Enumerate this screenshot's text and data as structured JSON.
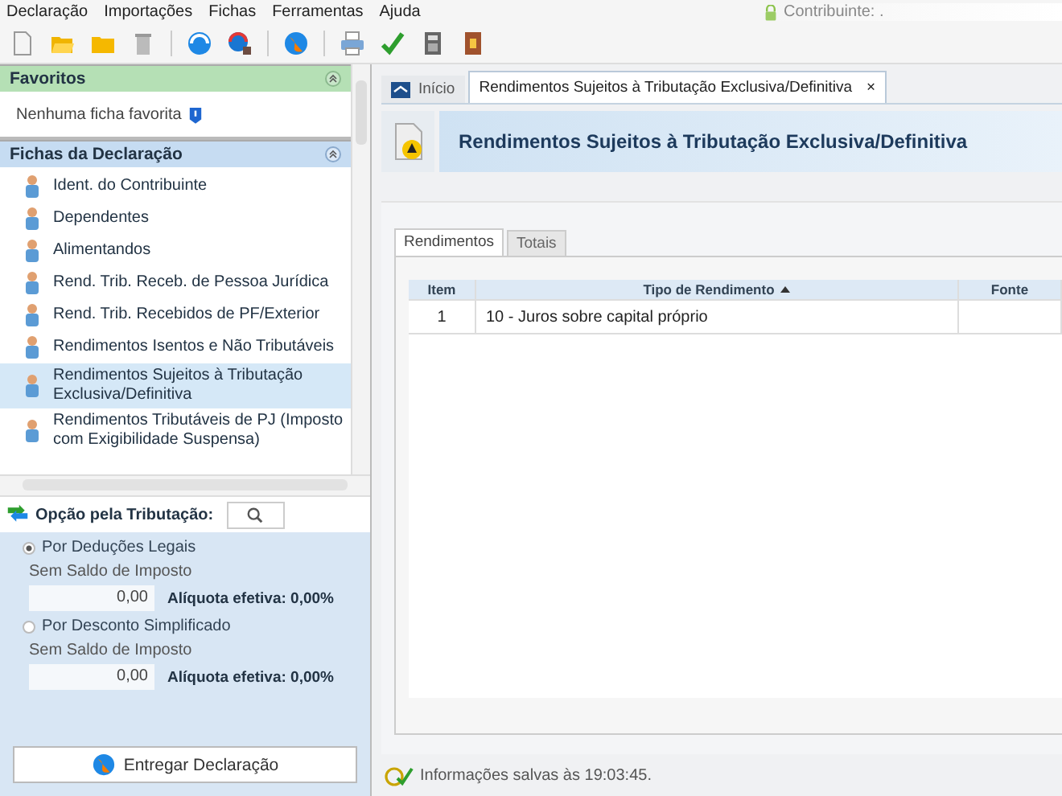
{
  "menu": [
    "Declaração",
    "Importações",
    "Fichas",
    "Ferramentas",
    "Ajuda"
  ],
  "contributor": {
    "label": "Contribuinte: ."
  },
  "favorites": {
    "title": "Favoritos",
    "empty_text": "Nenhuma ficha favorita"
  },
  "declaration_forms": {
    "title": "Fichas da Declaração",
    "items": [
      {
        "label": "Ident. do Contribuinte",
        "selected": false
      },
      {
        "label": "Dependentes",
        "selected": false
      },
      {
        "label": "Alimentandos",
        "selected": false
      },
      {
        "label": "Rend. Trib. Receb. de Pessoa Jurídica",
        "selected": false
      },
      {
        "label": "Rend. Trib. Recebidos de PF/Exterior",
        "selected": false
      },
      {
        "label": "Rendimentos Isentos e Não Tributáveis",
        "selected": false
      },
      {
        "label": "Rendimentos Sujeitos à Tributação Exclusiva/Definitiva",
        "selected": true
      },
      {
        "label": "Rendimentos Tributáveis de PJ (Imposto com Exigibilidade Suspensa)",
        "selected": false
      }
    ]
  },
  "tax_option": {
    "title": "Opção pela Tributação:",
    "options": [
      {
        "label": "Por Deduções Legais",
        "selected": true,
        "balance_label": "Sem Saldo de Imposto",
        "value": "0,00",
        "rate": "Alíquota efetiva: 0,00%"
      },
      {
        "label": "Por Desconto Simplificado",
        "selected": false,
        "balance_label": "Sem Saldo de Imposto",
        "value": "0,00",
        "rate": "Alíquota efetiva: 0,00%"
      }
    ]
  },
  "submit_button": "Entregar Declaração",
  "tabs": [
    {
      "label": "Início",
      "selected": false,
      "closable": false
    },
    {
      "label": "Rendimentos Sujeitos à Tributação Exclusiva/Definitiva",
      "selected": true,
      "closable": true
    }
  ],
  "close_mark": "×",
  "page_title": "Rendimentos Sujeitos à Tributação Exclusiva/Definitiva",
  "subtabs": [
    {
      "label": "Rendimentos",
      "selected": true
    },
    {
      "label": "Totais",
      "selected": false
    }
  ],
  "table": {
    "columns": [
      {
        "label": "Item",
        "sorted": false
      },
      {
        "label": "Tipo de Rendimento",
        "sorted": true
      },
      {
        "label": "Fonte",
        "sorted": false
      }
    ],
    "rows": [
      [
        "1",
        "10 - Juros sobre capital próprio",
        ""
      ]
    ]
  },
  "status_bar": "Informações salvas às 19:03:45."
}
